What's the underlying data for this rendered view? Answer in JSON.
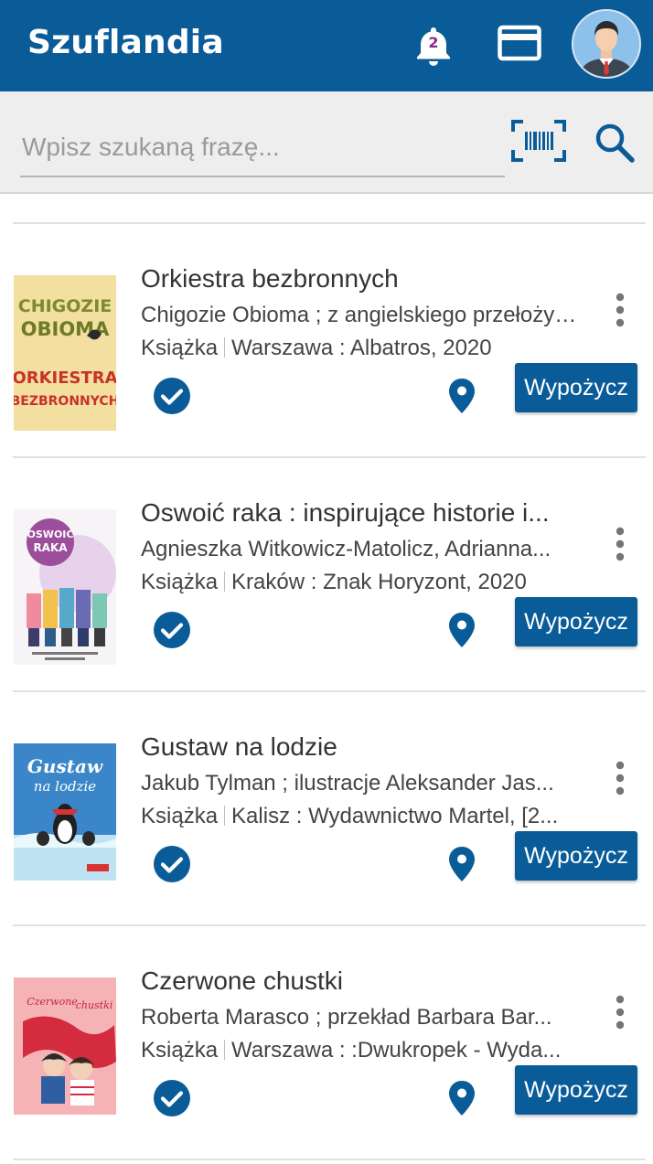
{
  "app": {
    "title": "Szuflandia",
    "notification_count": "2"
  },
  "search": {
    "placeholder": "Wpisz szukaną frazę..."
  },
  "colors": {
    "primary": "#0a5c99",
    "badge": "#8e2a8b"
  },
  "items": [
    {
      "title": "Orkiestra bezbronnych",
      "author": "Chigozie Obioma ; z angielskiego przełożyła...",
      "type": "Książka",
      "publication": "Warszawa : Albatros, 2020",
      "borrow_label": "Wypożycz",
      "cover_text": [
        "CHIGOZIE",
        "OBIOMA",
        "ORKIESTRA",
        "BEZBRONNYCH"
      ]
    },
    {
      "title": "Oswoić raka : inspirujące historie i...",
      "author": "Agnieszka Witkowicz-Matolicz, Adrianna...",
      "type": "Książka",
      "publication": "Kraków : Znak Horyzont, 2020",
      "borrow_label": "Wypożycz",
      "cover_text": [
        "OSWOIĆ",
        "RAKA"
      ]
    },
    {
      "title": "Gustaw na lodzie",
      "author": "Jakub Tylman ; ilustracje Aleksander Jas...",
      "type": "Książka",
      "publication": "Kalisz : Wydawnictwo Martel, [2...",
      "borrow_label": "Wypożycz",
      "cover_text": [
        "Gustaw",
        "na lodzie"
      ]
    },
    {
      "title": "Czerwone chustki",
      "author": "Roberta Marasco ; przekład Barbara Bar...",
      "type": "Książka",
      "publication": "Warszawa : :Dwukropek - Wyda...",
      "borrow_label": "Wypożycz",
      "cover_text": [
        "Czerwone",
        "chustki"
      ]
    }
  ]
}
